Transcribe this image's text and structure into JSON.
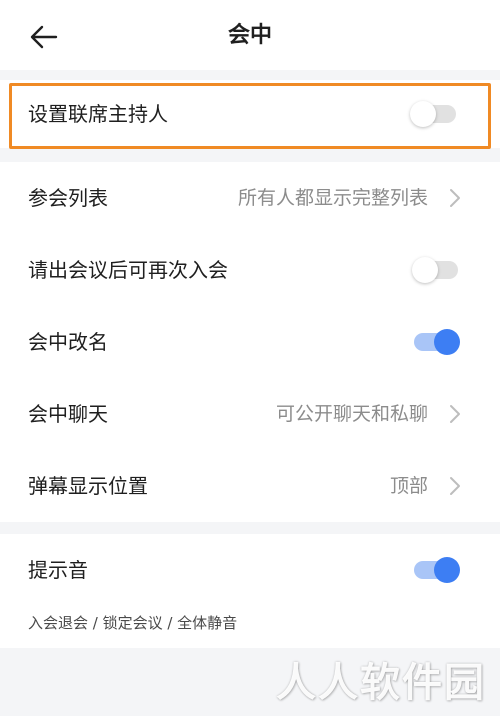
{
  "header": {
    "title": "会中",
    "back_icon": "arrow-left-icon"
  },
  "settings_group_1": {
    "co_host": {
      "label": "设置联席主持人",
      "toggle_on": false
    }
  },
  "settings_group_2": {
    "participant_list": {
      "label": "参会列表",
      "value": "所有人都显示完整列表"
    },
    "rejoin_after_removal": {
      "label": "请出会议后可再次入会",
      "toggle_on": false
    },
    "rename_in_meeting": {
      "label": "会中改名",
      "toggle_on": true
    },
    "chat_in_meeting": {
      "label": "会中聊天",
      "value": "可公开聊天和私聊"
    },
    "danmaku_position": {
      "label": "弹幕显示位置",
      "value": "顶部"
    }
  },
  "settings_group_3": {
    "sound_prompt": {
      "label": "提示音",
      "toggle_on": true
    },
    "footnote": "入会退会 / 锁定会议 / 全体静音"
  },
  "watermark": "人人软件园",
  "colors": {
    "accent_blue": "#3d7ef3",
    "toggle_track_on": "#a9c5f7",
    "toggle_track_off": "#e1e1e1",
    "highlight_orange": "#f08a24"
  }
}
